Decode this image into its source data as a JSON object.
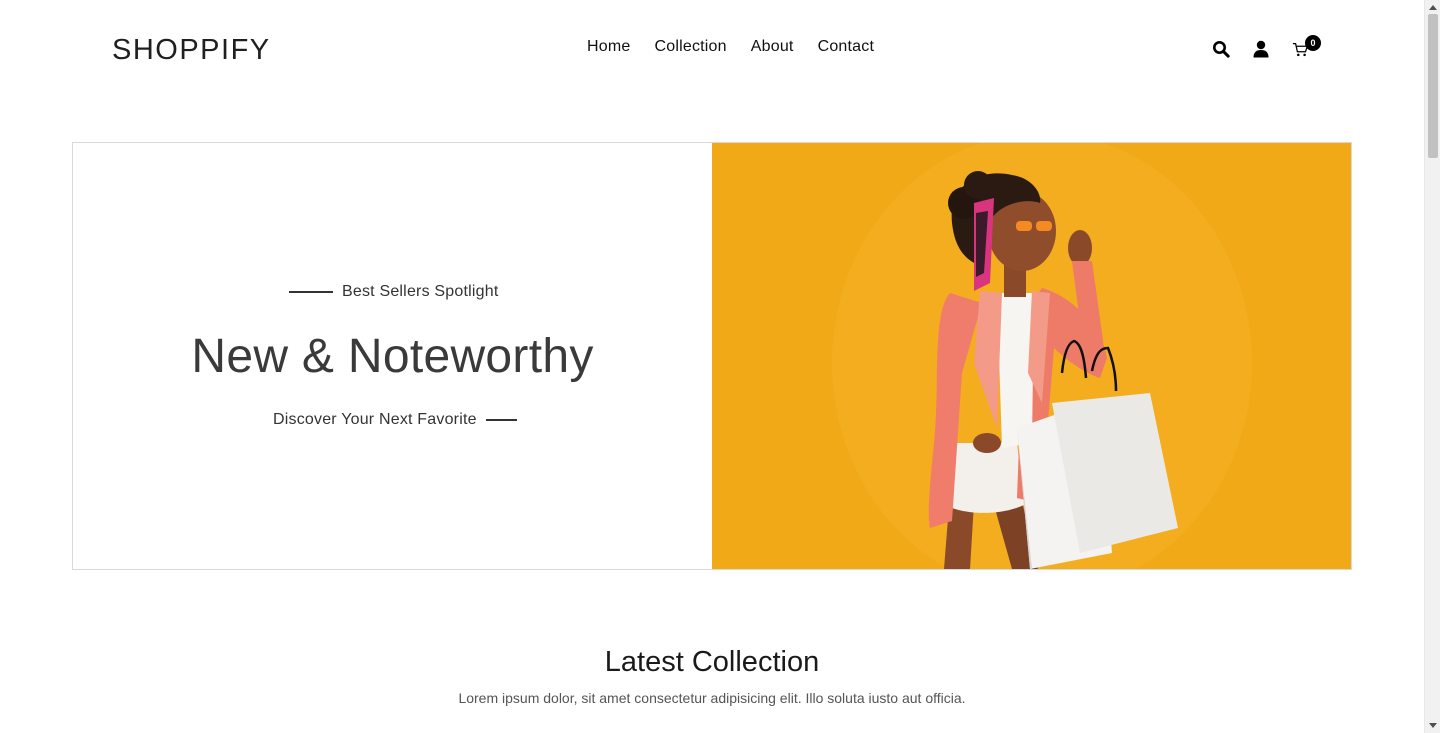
{
  "header": {
    "logo": "SHOPPIFY",
    "nav": [
      {
        "label": "Home"
      },
      {
        "label": "Collection"
      },
      {
        "label": "About"
      },
      {
        "label": "Contact"
      }
    ],
    "icons": [
      "search-icon",
      "user-icon",
      "cart-icon"
    ],
    "cart_count": "0"
  },
  "hero": {
    "eyebrow": "Best Sellers Spotlight",
    "title": "New & Noteworthy",
    "subtitle": "Discover Your Next Favorite",
    "image_bg": "#f2a917"
  },
  "latest": {
    "title": "Latest Collection",
    "description": "Lorem ipsum dolor, sit amet consectetur adipisicing elit. Illo soluta iusto aut officia."
  }
}
